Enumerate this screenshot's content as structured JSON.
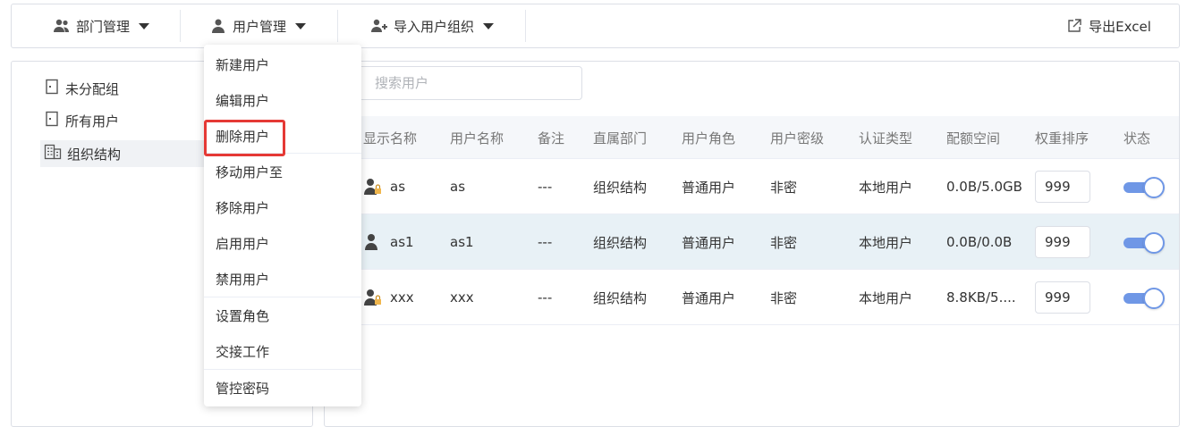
{
  "toolbar": {
    "dept_label": "部门管理",
    "user_label": "用户管理",
    "import_label": "导入用户组织",
    "export_label": "导出Excel"
  },
  "tree": {
    "items": [
      {
        "label": "未分配组"
      },
      {
        "label": "所有用户"
      },
      {
        "label": "组织结构"
      }
    ]
  },
  "search": {
    "placeholder": "搜索用户"
  },
  "table": {
    "headers": [
      "显示名称",
      "用户名称",
      "备注",
      "直属部门",
      "用户角色",
      "用户密级",
      "认证类型",
      "配额空间",
      "权重排序",
      "状态"
    ],
    "rows": [
      {
        "display": "as",
        "username": "as",
        "note": "---",
        "dept": "组织结构",
        "role": "普通用户",
        "level": "非密",
        "auth": "本地用户",
        "quota": "0.0B/5.0GB",
        "weight": "999",
        "enabled": true
      },
      {
        "display": "as1",
        "username": "as1",
        "note": "---",
        "dept": "组织结构",
        "role": "普通用户",
        "level": "非密",
        "auth": "本地用户",
        "quota": "0.0B/0.0B",
        "weight": "999",
        "enabled": true
      },
      {
        "display": "xxx",
        "username": "xxx",
        "note": "---",
        "dept": "组织结构",
        "role": "普通用户",
        "level": "非密",
        "auth": "本地用户",
        "quota": "8.8KB/5....",
        "weight": "999",
        "enabled": true
      }
    ]
  },
  "menu": {
    "items": [
      "新建用户",
      "编辑用户",
      "删除用户",
      "移动用户至",
      "移除用户",
      "启用用户",
      "禁用用户",
      "设置角色",
      "交接工作",
      "管控密码"
    ]
  },
  "colors": {
    "accent": "#6f97e6",
    "highlight_row": "#e8f1f6",
    "alert_border": "#e53935"
  }
}
